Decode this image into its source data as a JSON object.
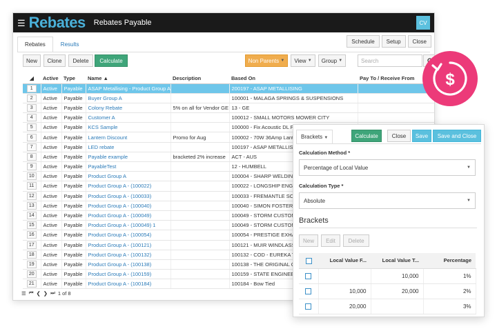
{
  "app": {
    "logo": "Rebates",
    "title": "Rebates Payable",
    "user_initials": "CV"
  },
  "tabs": [
    "Rebates",
    "Results"
  ],
  "header_buttons": [
    "Schedule",
    "Setup",
    "Close"
  ],
  "toolbar": {
    "new": "New",
    "clone": "Clone",
    "delete": "Delete",
    "calculate": "Calculate",
    "non_parents": "Non Parents",
    "view": "View",
    "group": "Group",
    "search_placeholder": "Search"
  },
  "grid": {
    "columns": [
      "Active",
      "Type",
      "Name",
      "Description",
      "Based On",
      "Pay To / Receive From"
    ],
    "rows": [
      {
        "num": "1",
        "active": "Active",
        "type": "Payable",
        "name": "ASAP Metallising - Product Group A",
        "desc": "",
        "based": "200197 - ASAP METALLISING"
      },
      {
        "num": "2",
        "active": "Active",
        "type": "Payable",
        "name": "Buyer Group A",
        "desc": "",
        "based": "100001 - MALAGA SPRINGS & SUSPENSIONS"
      },
      {
        "num": "3",
        "active": "Active",
        "type": "Payable",
        "name": "Colony Rebate",
        "desc": "5% on all for Vendor GE",
        "based": "13 - GE"
      },
      {
        "num": "4",
        "active": "Active",
        "type": "Payable",
        "name": "Customer A",
        "desc": "",
        "based": "100012 - SMALL MOTORS MOWER CITY"
      },
      {
        "num": "5",
        "active": "Active",
        "type": "Payable",
        "name": "KCS Sample",
        "desc": "",
        "based": "100000 - Fix Acoustic DL Fir"
      },
      {
        "num": "6",
        "active": "Active",
        "type": "Payable",
        "name": "Lantern Discount",
        "desc": "Promo for Aug",
        "based": "100002 - 70W 36Amp Lantern"
      },
      {
        "num": "7",
        "active": "Active",
        "type": "Payable",
        "name": "LED rebate",
        "desc": "",
        "based": "100197 - ASAP METALLISIN"
      },
      {
        "num": "8",
        "active": "Active",
        "type": "Payable",
        "name": "Payable example",
        "desc": "bracketed 2% increase",
        "based": "ACT - AUS"
      },
      {
        "num": "9",
        "active": "Active",
        "type": "Payable",
        "name": "PayableTest",
        "desc": "",
        "based": "12 - HUMBELL"
      },
      {
        "num": "10",
        "active": "Active",
        "type": "Payable",
        "name": "Product Group A",
        "desc": "",
        "based": "100004 - SHARP WELDING"
      },
      {
        "num": "11",
        "active": "Active",
        "type": "Payable",
        "name": "Product Group A - (100022)",
        "desc": "",
        "based": "100022 - LONGSHIP ENGIN"
      },
      {
        "num": "12",
        "active": "Active",
        "type": "Payable",
        "name": "Product Group A - (100033)",
        "desc": "",
        "based": "100033 - FREMANTLE SCHO"
      },
      {
        "num": "13",
        "active": "Active",
        "type": "Payable",
        "name": "Product Group A - (100040)",
        "desc": "",
        "based": "100040 - SIMON FOSTER M"
      },
      {
        "num": "14",
        "active": "Active",
        "type": "Payable",
        "name": "Product Group A - (100049)",
        "desc": "",
        "based": "100049 - STORM CUSTOM T"
      },
      {
        "num": "15",
        "active": "Active",
        "type": "Payable",
        "name": "Product Group A - (100049) 1",
        "desc": "",
        "based": "100049 - STORM CUSTOM T"
      },
      {
        "num": "16",
        "active": "Active",
        "type": "Payable",
        "name": "Product Group A - (100054)",
        "desc": "",
        "based": "100054 - PRESTIGE EXHAU"
      },
      {
        "num": "17",
        "active": "Active",
        "type": "Payable",
        "name": "Product Group A - (100121)",
        "desc": "",
        "based": "100121 - MUIR WINDLASSE"
      },
      {
        "num": "18",
        "active": "Active",
        "type": "Payable",
        "name": "Product Group A - (100132)",
        "desc": "",
        "based": "100132 - COD - EUREKA TR"
      },
      {
        "num": "19",
        "active": "Active",
        "type": "Payable",
        "name": "Product Group A - (100138)",
        "desc": "",
        "based": "100138 - THE ORIGINAL CR"
      },
      {
        "num": "20",
        "active": "Active",
        "type": "Payable",
        "name": "Product Group A - (100159)",
        "desc": "",
        "based": "100159 - STATE ENGINEERI"
      },
      {
        "num": "21",
        "active": "Active",
        "type": "Payable",
        "name": "Product Group A - (100184)",
        "desc": "",
        "based": "100184 - Bow Tied"
      }
    ]
  },
  "pager": {
    "text": "1 of 8"
  },
  "panel": {
    "tab": "Brackets",
    "buttons": {
      "calculate": "Calculate",
      "close": "Close",
      "save": "Save",
      "save_close": "Save and Close"
    },
    "calc_method_label": "Calculation Method *",
    "calc_method_value": "Percentage of Local Value",
    "calc_type_label": "Calculation Type *",
    "calc_type_value": "Absolute",
    "section_title": "Brackets",
    "bracket_buttons": {
      "new": "New",
      "edit": "Edit",
      "delete": "Delete"
    },
    "bracket_columns": [
      "Local Value F...",
      "Local Value T...",
      "Percentage"
    ],
    "brackets": [
      {
        "from": "",
        "to": "10,000",
        "pct": "1%"
      },
      {
        "from": "10,000",
        "to": "20,000",
        "pct": "2%"
      },
      {
        "from": "20,000",
        "to": "",
        "pct": "3%"
      }
    ]
  },
  "colors": {
    "accent": "#4ab0d9",
    "selected_row": "#6ec6ea",
    "green": "#3fa57a",
    "orange": "#f0ad4e",
    "badge": "#ec3a79"
  },
  "icons": [
    "menu-icon",
    "search-icon",
    "sort-icon",
    "rebate-dollar-icon",
    "first-page-icon",
    "prev-page-icon",
    "next-page-icon",
    "last-page-icon"
  ]
}
